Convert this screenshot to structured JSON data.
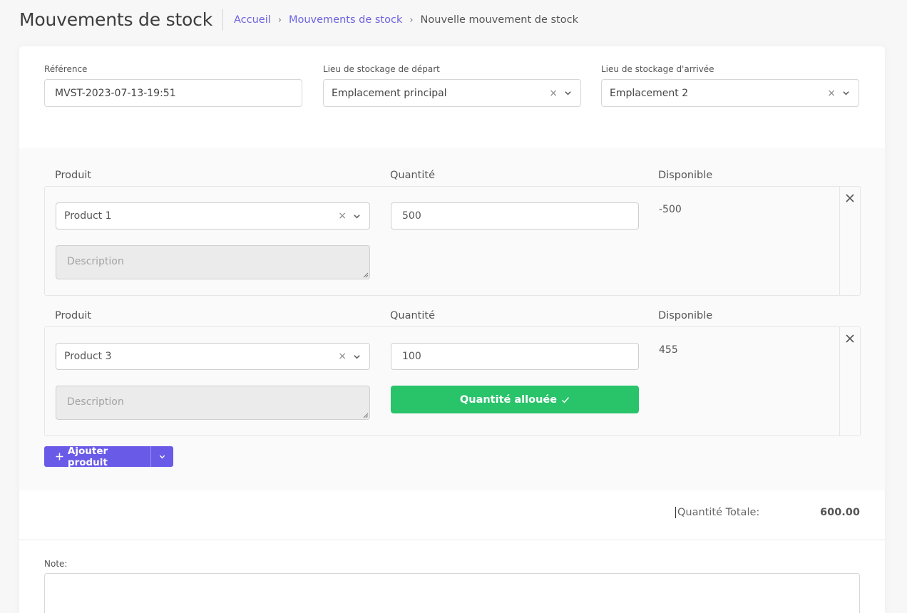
{
  "header": {
    "title": "Mouvements de stock",
    "breadcrumb": [
      "Accueil",
      "Mouvements de stock",
      "Nouvelle mouvement de stock"
    ]
  },
  "form": {
    "reference": {
      "label": "Référence",
      "value": "MVST-2023-07-13-19:51"
    },
    "from_location": {
      "label": "Lieu de stockage de départ",
      "value": "Emplacement principal"
    },
    "to_location": {
      "label": "Lieu de stockage d'arrivée",
      "value": "Emplacement 2"
    }
  },
  "lines": [
    {
      "col_product": "Produit",
      "col_quantity": "Quantité",
      "col_available": "Disponible",
      "product": "Product 1",
      "quantity": "500",
      "available": "-500",
      "description_placeholder": "Description"
    },
    {
      "col_product": "Produit",
      "col_quantity": "Quantité",
      "col_available": "Disponible",
      "product": "Product 3",
      "quantity": "100",
      "available": "455",
      "description_placeholder": "Description",
      "allocated_label": "Quantité allouée"
    }
  ],
  "add_product_label": "Ajouter produit",
  "totals": {
    "label": "Quantité Totale:",
    "value": "600.00"
  },
  "note": {
    "label": "Note:"
  },
  "colors": {
    "accent": "#6a5ae8",
    "success": "#29c36a",
    "link": "#6c63e0"
  }
}
